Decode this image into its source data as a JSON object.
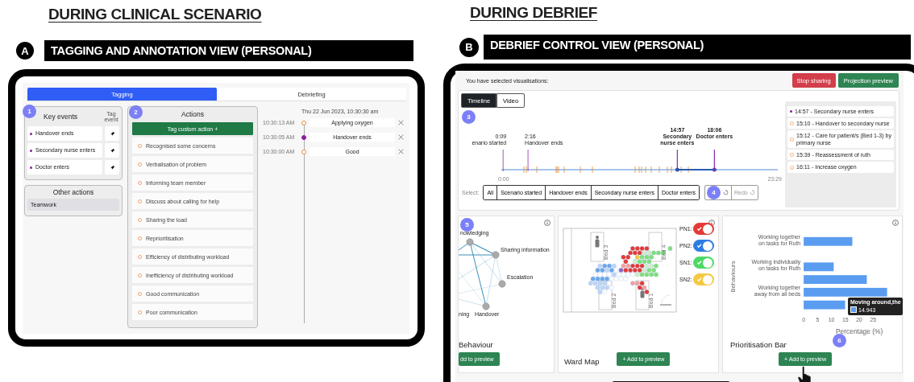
{
  "left": {
    "heading": "DURING CLINICAL SCENARIO",
    "badge": "A",
    "title": "TAGGING AND ANNOTATION VIEW (PERSONAL)",
    "tabs": [
      {
        "label": "Tagging",
        "selected": true
      },
      {
        "label": "Debriefing",
        "selected": false
      }
    ],
    "key_events": {
      "step": "1",
      "title": "Key events",
      "column_label": "Tag event",
      "items": [
        "Handover ends",
        "Secondary nurse enters",
        "Doctor enters"
      ]
    },
    "other_actions": {
      "title": "Other actions",
      "items": [
        "Teamwork"
      ]
    },
    "actions": {
      "step": "2",
      "title": "Actions",
      "button": "Tag custom action +",
      "items": [
        "Recognised some concerns",
        "Verbalisation of problem",
        "Informing team member",
        "Discuss about calling for help",
        "Sharing the load",
        "Reprioritisation",
        "Efficiency of distributing workload",
        "Inefficiency of distributing workload",
        "Good communication",
        "Poor communication"
      ]
    },
    "log": {
      "date": "Thu 22 Jun 2023, 10:30:30 am",
      "entries": [
        {
          "time": "10:30:13 AM",
          "label": "Applying oxygen",
          "kind": "action"
        },
        {
          "time": "10:30:05 AM",
          "label": "Handover ends",
          "kind": "event"
        },
        {
          "time": "10:30:00 AM",
          "label": "Good",
          "kind": "action"
        }
      ]
    }
  },
  "right": {
    "heading": "DURING DEBRIEF",
    "badge": "B",
    "title": "DEBRIEF CONTROL VIEW (PERSONAL)",
    "selected_text": "You have selected visualisations:",
    "buttons": [
      {
        "label": "Stop sharing",
        "kind": "danger"
      },
      {
        "label": "Projection preview",
        "kind": "success"
      }
    ],
    "view_tabs": [
      {
        "label": "Timeline",
        "selected": true
      },
      {
        "label": "Video",
        "selected": false
      }
    ],
    "timeline": {
      "step": "3",
      "markers": [
        {
          "time": "0:09",
          "label": "enario started",
          "selected": false
        },
        {
          "time": "2:16",
          "label": "Handover ends",
          "selected": false
        },
        {
          "time": "14:57",
          "label": "Secondary nurse enters",
          "selected": true
        },
        {
          "time": "18:06",
          "label": "Doctor enters",
          "selected": true
        }
      ],
      "start": "0:00",
      "end": "23:29",
      "select_label": "Select:",
      "filters": [
        "All",
        "Scenario started",
        "Handover ends",
        "Secondary nurse enters",
        "Doctor enters"
      ],
      "undo_step": "4",
      "redo": "Redo"
    },
    "events": [
      {
        "label": "14:57 - Secondary nurse enters",
        "kind": "key"
      },
      {
        "label": "15:10 - Handover to secondary nurse",
        "kind": "action"
      },
      {
        "label": "15:12 - Care for patient/s (Bed 1-3) by primary nurse",
        "kind": "action"
      },
      {
        "label": "15:39 - Reassessment of ruth",
        "kind": "action"
      },
      {
        "label": "16:11 - Increase oxygen",
        "kind": "action"
      }
    ],
    "network": {
      "step": "5",
      "labels": [
        "nowledging",
        "Sharing information",
        "Escalation",
        "ning",
        "Handover"
      ],
      "title": "Behaviour",
      "button": "dd to preview"
    },
    "ward_map": {
      "title": "Ward Map",
      "button": "+ Add to preview",
      "beds": [
        "Bed 3",
        "Bed 4",
        "Bed 2",
        "Bed 1"
      ],
      "toggles": [
        {
          "label": "PN1:",
          "color": "#e53935",
          "on": true
        },
        {
          "label": "PN2:",
          "color": "#2f7de1",
          "on": true
        },
        {
          "label": "SN1:",
          "color": "#4cd964",
          "on": true
        },
        {
          "label": "SN2:",
          "color": "#f5c842",
          "on": true
        }
      ]
    },
    "prioritisation": {
      "title": "Prioritisation Bar",
      "button": "+ Add to preview",
      "step": "6",
      "tooltip": {
        "title": "Moving around,the",
        "value": "14.943"
      },
      "chart_data": {
        "type": "bar",
        "orientation": "horizontal",
        "xlabel": "Percentage (%)",
        "ylabel": "Behaviours",
        "categories": [
          "Working together on tasks for Ruth",
          "Working individually on tasks for Ruth",
          null,
          "Working together away from all beds",
          null
        ],
        "series": [
          {
            "color": "#5a9cf0",
            "values": [
              17.5,
              10.8,
              22.7,
              30,
              14.9
            ]
          }
        ],
        "xlim": [
          0,
          30
        ],
        "xticks": [
          0,
          5,
          10,
          15,
          20,
          25
        ]
      }
    }
  }
}
